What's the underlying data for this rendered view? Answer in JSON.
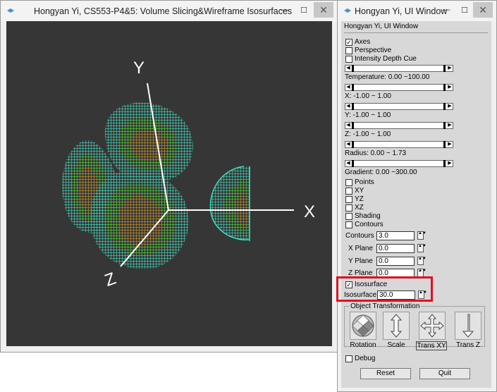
{
  "main_window": {
    "title": "Hongyan Yi, CS553-P4&5: Volume Slicing&Wireframe Isosurfaces",
    "minimize_glyph": "—",
    "maximize_glyph": "☐",
    "close_glyph": "✕"
  },
  "viewport": {
    "axis_labels": {
      "x": "X",
      "y": "Y",
      "z": "Z"
    },
    "colors": {
      "background": "#363636",
      "outer_mesh": "#3fe0c0",
      "mid_mesh": "#4ed020",
      "inner_mesh": "#e07818",
      "axes": "#ffffff"
    }
  },
  "ui_window": {
    "title": "Hongyan Yi, UI Window",
    "panel_title": "Hongyan Yi, UI Window",
    "minimize_glyph": "—",
    "maximize_glyph": "☐",
    "close_glyph": "✕",
    "checkboxes_top": [
      {
        "label": "Axes",
        "checked": true,
        "mark": "✓"
      },
      {
        "label": "Perspective",
        "checked": false,
        "mark": ""
      },
      {
        "label": "Intensity Depth Cue",
        "checked": false,
        "mark": ""
      }
    ],
    "range_labels": {
      "temperature": "Temperature:  0.00 ~100.00",
      "x": "X:  -1.00 ~ 1.00",
      "y": "Y:  -1.00 ~ 1.00",
      "z": "Z:  -1.00 ~ 1.00",
      "radius": "Radius:  0.00 ~ 1.73",
      "gradient": "Gradient:  0.00 ~300.00"
    },
    "slider_arrows": {
      "left": "◀",
      "right": "▶"
    },
    "checkboxes_mid": [
      {
        "label": "Points",
        "checked": false,
        "mark": ""
      },
      {
        "label": "XY",
        "checked": false,
        "mark": ""
      },
      {
        "label": "YZ",
        "checked": false,
        "mark": ""
      },
      {
        "label": "XZ",
        "checked": false,
        "mark": ""
      },
      {
        "label": "Shading",
        "checked": false,
        "mark": ""
      },
      {
        "label": "Contours",
        "checked": false,
        "mark": ""
      }
    ],
    "spinners": {
      "contours": {
        "label": "Contours",
        "value": "3.0"
      },
      "x_plane": {
        "label": "X Plane",
        "value": "0.0"
      },
      "y_plane": {
        "label": "Y Plane",
        "value": "0.0"
      },
      "z_plane": {
        "label": "Z Plane",
        "value": "0.0"
      },
      "isosurface": {
        "label": "Isosurface",
        "value": "30.0"
      }
    },
    "spin_glyph": "▲▼",
    "isosurface_checkbox": {
      "label": "Isosurface",
      "checked": true,
      "mark": "✓"
    },
    "object_transformation": {
      "title": "Object Transformation",
      "buttons": [
        "Rotation",
        "Scale",
        "Trans XY",
        "Trans Z"
      ]
    },
    "debug": {
      "label": "Debug",
      "checked": false,
      "mark": ""
    },
    "reset_label": "Reset",
    "quit_label": "Quit",
    "highlight_color": "#e01020"
  }
}
